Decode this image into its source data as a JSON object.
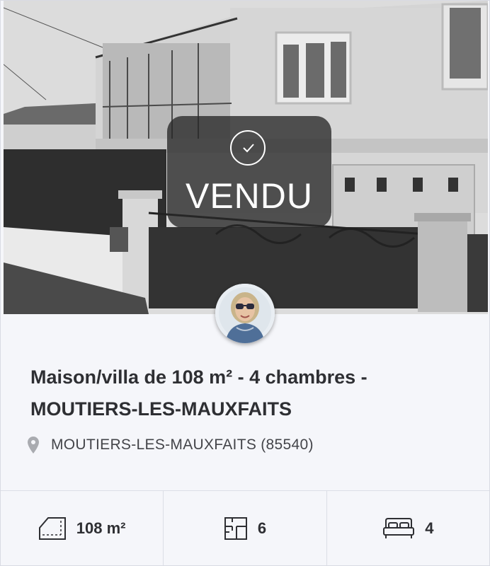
{
  "listing": {
    "status_label": "VENDU",
    "title": "Maison/villa de 108 m² - 4 chambres - MOUTIERS-LES-MAUXFAITS",
    "location": "MOUTIERS-LES-MAUXFAITS (85540)"
  },
  "features": [
    {
      "icon": "surface-area-icon",
      "value": "108 m²"
    },
    {
      "icon": "floor-plan-rooms-icon",
      "value": "6"
    },
    {
      "icon": "bed-icon",
      "value": "4"
    }
  ],
  "colors": {
    "text": "#2e2f33",
    "card_background": "#f5f6fa",
    "badge_overlay": "#282828",
    "divider": "#dcdee6"
  }
}
